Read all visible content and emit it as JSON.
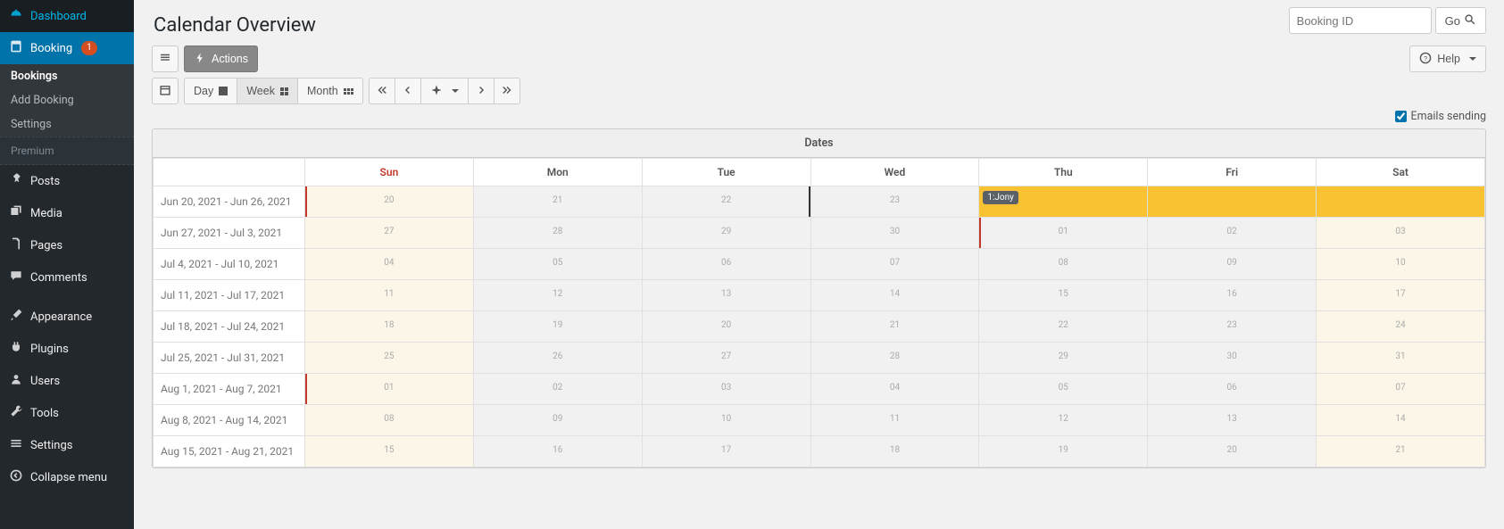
{
  "sidebar": {
    "items": [
      {
        "id": "dashboard",
        "label": "Dashboard"
      },
      {
        "id": "booking",
        "label": "Booking",
        "badge": "1",
        "active": true,
        "sub": [
          {
            "label": "Bookings",
            "current": true
          },
          {
            "label": "Add Booking"
          },
          {
            "label": "Settings"
          }
        ]
      },
      {
        "section": "Premium"
      },
      {
        "id": "posts",
        "label": "Posts"
      },
      {
        "id": "media",
        "label": "Media"
      },
      {
        "id": "pages",
        "label": "Pages"
      },
      {
        "id": "comments",
        "label": "Comments"
      },
      {
        "id": "appearance",
        "label": "Appearance"
      },
      {
        "id": "plugins",
        "label": "Plugins"
      },
      {
        "id": "users",
        "label": "Users"
      },
      {
        "id": "tools",
        "label": "Tools"
      },
      {
        "id": "settings",
        "label": "Settings"
      },
      {
        "id": "collapse",
        "label": "Collapse menu"
      }
    ]
  },
  "page": {
    "title": "Calendar Overview"
  },
  "search": {
    "placeholder": "Booking ID",
    "go": "Go"
  },
  "toolbar": {
    "actions": "Actions",
    "help": "Help",
    "view_day": "Day",
    "view_week": "Week",
    "view_month": "Month"
  },
  "emails": {
    "label": "Emails sending",
    "checked": true
  },
  "calendar": {
    "dates_label": "Dates",
    "today_col_index": 2,
    "days": [
      "Sun",
      "Mon",
      "Tue",
      "Wed",
      "Thu",
      "Fri",
      "Sat"
    ],
    "rows": [
      {
        "label": "Jun 20, 2021 - Jun 26, 2021",
        "cells": [
          {
            "n": "20",
            "weekend": true,
            "leftred": true
          },
          {
            "n": "21"
          },
          {
            "n": "22",
            "today": true
          },
          {
            "n": "23"
          },
          {
            "n": "",
            "highlight": true,
            "booking": "1:Jony"
          },
          {
            "n": "",
            "highlight": true
          },
          {
            "n": "",
            "highlight": true,
            "weekend": true
          }
        ]
      },
      {
        "label": "Jun 27, 2021 - Jul 3, 2021",
        "cells": [
          {
            "n": "27",
            "weekend": true
          },
          {
            "n": "28"
          },
          {
            "n": "29"
          },
          {
            "n": "30"
          },
          {
            "n": "01",
            "leftred": true
          },
          {
            "n": "02"
          },
          {
            "n": "03",
            "weekend": true
          }
        ]
      },
      {
        "label": "Jul 4, 2021 - Jul 10, 2021",
        "cells": [
          {
            "n": "04",
            "weekend": true
          },
          {
            "n": "05"
          },
          {
            "n": "06"
          },
          {
            "n": "07"
          },
          {
            "n": "08"
          },
          {
            "n": "09"
          },
          {
            "n": "10",
            "weekend": true
          }
        ]
      },
      {
        "label": "Jul 11, 2021 - Jul 17, 2021",
        "cells": [
          {
            "n": "11",
            "weekend": true
          },
          {
            "n": "12"
          },
          {
            "n": "13"
          },
          {
            "n": "14"
          },
          {
            "n": "15"
          },
          {
            "n": "16"
          },
          {
            "n": "17",
            "weekend": true
          }
        ]
      },
      {
        "label": "Jul 18, 2021 - Jul 24, 2021",
        "cells": [
          {
            "n": "18",
            "weekend": true
          },
          {
            "n": "19"
          },
          {
            "n": "20"
          },
          {
            "n": "21"
          },
          {
            "n": "22"
          },
          {
            "n": "23"
          },
          {
            "n": "24",
            "weekend": true
          }
        ]
      },
      {
        "label": "Jul 25, 2021 - Jul 31, 2021",
        "cells": [
          {
            "n": "25",
            "weekend": true
          },
          {
            "n": "26"
          },
          {
            "n": "27"
          },
          {
            "n": "28"
          },
          {
            "n": "29"
          },
          {
            "n": "30"
          },
          {
            "n": "31",
            "weekend": true
          }
        ]
      },
      {
        "label": "Aug 1, 2021 - Aug 7, 2021",
        "cells": [
          {
            "n": "01",
            "weekend": true,
            "leftred": true
          },
          {
            "n": "02"
          },
          {
            "n": "03"
          },
          {
            "n": "04"
          },
          {
            "n": "05"
          },
          {
            "n": "06"
          },
          {
            "n": "07",
            "weekend": true
          }
        ]
      },
      {
        "label": "Aug 8, 2021 - Aug 14, 2021",
        "cells": [
          {
            "n": "08",
            "weekend": true
          },
          {
            "n": "09"
          },
          {
            "n": "10"
          },
          {
            "n": "11"
          },
          {
            "n": "12"
          },
          {
            "n": "13"
          },
          {
            "n": "14",
            "weekend": true
          }
        ]
      },
      {
        "label": "Aug 15, 2021 - Aug 21, 2021",
        "cells": [
          {
            "n": "15",
            "weekend": true
          },
          {
            "n": "16"
          },
          {
            "n": "17"
          },
          {
            "n": "18"
          },
          {
            "n": "19"
          },
          {
            "n": "20"
          },
          {
            "n": "21",
            "weekend": true
          }
        ]
      }
    ]
  }
}
